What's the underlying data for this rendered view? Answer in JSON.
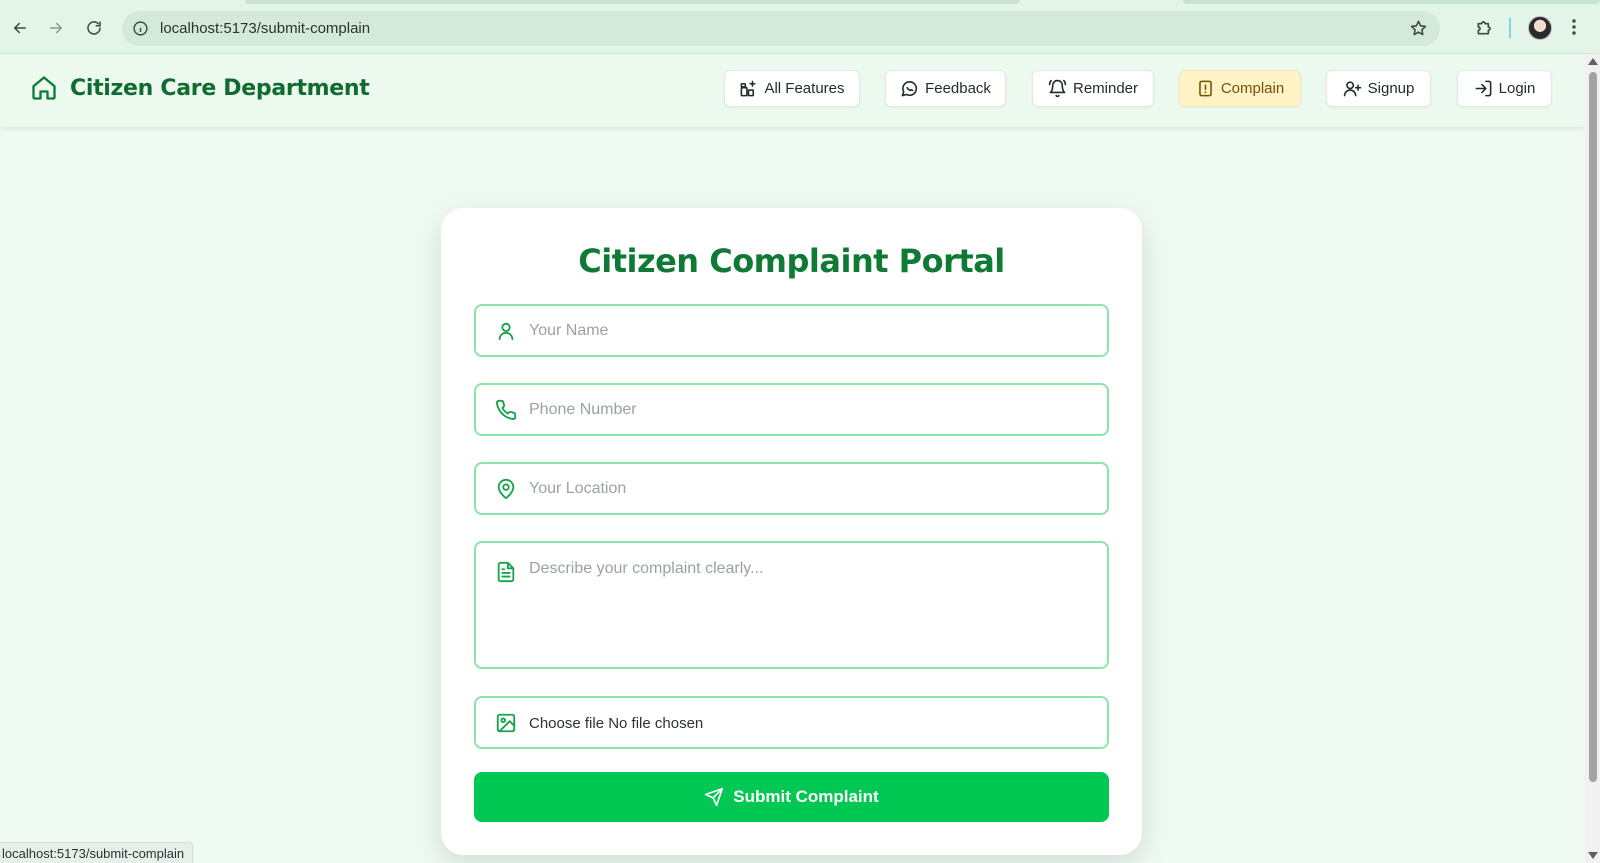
{
  "browser": {
    "url": "localhost:5173/submit-complain",
    "status_url": "localhost:5173/submit-complain"
  },
  "header": {
    "brand": "Citizen Care Department",
    "nav": [
      {
        "label": "All Features",
        "icon": "grid-plus-icon"
      },
      {
        "label": "Feedback",
        "icon": "message-circle-icon"
      },
      {
        "label": "Reminder",
        "icon": "bell-ring-icon"
      },
      {
        "label": "Complain",
        "icon": "alert-file-icon",
        "active": true
      },
      {
        "label": "Signup",
        "icon": "user-plus-icon"
      },
      {
        "label": "Login",
        "icon": "log-in-icon"
      }
    ]
  },
  "form": {
    "title": "Citizen Complaint Portal",
    "name_placeholder": "Your Name",
    "phone_placeholder": "Phone Number",
    "location_placeholder": "Your Location",
    "description_placeholder": "Describe your complaint clearly...",
    "file_text": "Choose file No file chosen",
    "submit_label": "Submit Complaint"
  },
  "colors": {
    "brand_green": "#0f7a35",
    "accent_green": "#00c853",
    "field_border": "#8be3ad",
    "active_nav_bg": "#fdf3c4",
    "page_bg": "#eefaf2"
  }
}
